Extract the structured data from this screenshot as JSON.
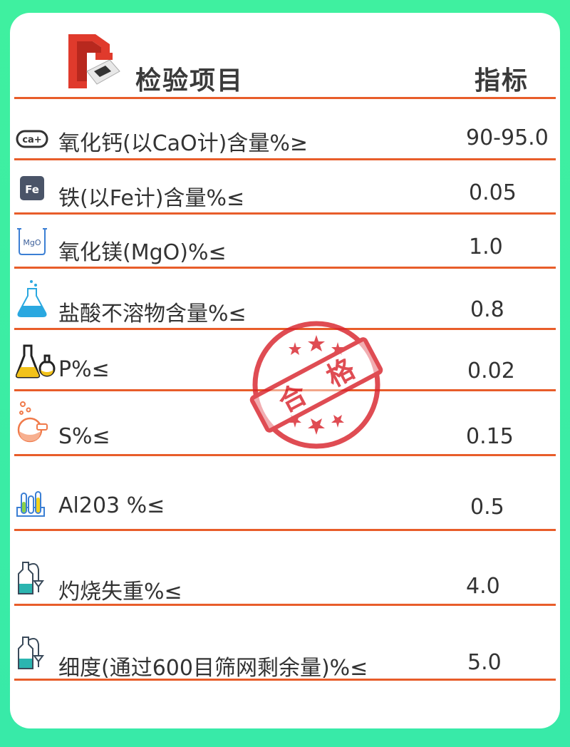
{
  "header": {
    "title": "检验项目",
    "value_header": "指标"
  },
  "rows": [
    {
      "icon": "calcium-ion-icon",
      "icon_text": "ca+",
      "label": "氧化钙(以CaO计)含量%≥",
      "value": "90-95.0"
    },
    {
      "icon": "iron-element-icon",
      "icon_text": "Fe",
      "label": "铁(以Fe计)含量%≤",
      "value": "0.05"
    },
    {
      "icon": "mgo-beaker-icon",
      "icon_text": "MgO",
      "label": "氧化镁(MgO)%≤",
      "value": "1.0"
    },
    {
      "icon": "flask-icon",
      "label": "盐酸不溶物含量%≤",
      "value": "0.8"
    },
    {
      "icon": "lab-flasks-icon",
      "label": "P%≤",
      "value": "0.02"
    },
    {
      "icon": "bubbling-flask-icon",
      "label": "S%≤",
      "value": "0.15"
    },
    {
      "icon": "test-tubes-icon",
      "label": "Al203 %≤",
      "value": "0.5"
    },
    {
      "icon": "distillation-bottle-icon",
      "label": "灼烧失重%≤",
      "value": "4.0"
    },
    {
      "icon": "distillation-bottle-icon",
      "label": "细度(通过600目筛网剩余量)%≤",
      "value": "5.0"
    }
  ],
  "stamp": {
    "text_left": "合",
    "text_right": "格"
  },
  "colors": {
    "accent": "#e85d2a",
    "background": "#3ff0a0",
    "stamp": "#d9252e"
  }
}
